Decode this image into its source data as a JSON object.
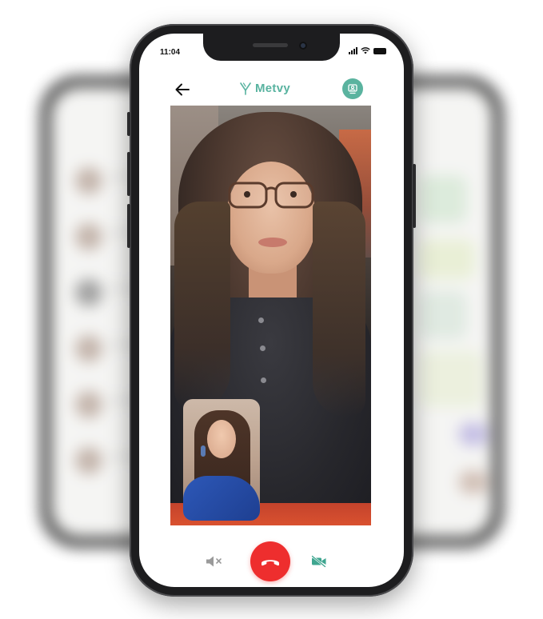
{
  "status_bar": {
    "time": "11:04"
  },
  "header": {
    "back_icon": "arrow-left-icon",
    "brand_name": "Metvy",
    "brand_icon": "metvy-logo-icon",
    "profile_icon": "user-badge-icon"
  },
  "call": {
    "remote_video": "remote-participant-video",
    "self_video": "local-participant-preview"
  },
  "controls": {
    "mute_icon": "speaker-mute-icon",
    "end_call_icon": "phone-hangup-icon",
    "video_off_icon": "video-off-icon"
  },
  "colors": {
    "brand": "#59b3a0",
    "end_call": "#ee2e2e",
    "video_icon": "#3fa690",
    "mute_icon": "#9a9a9a"
  }
}
